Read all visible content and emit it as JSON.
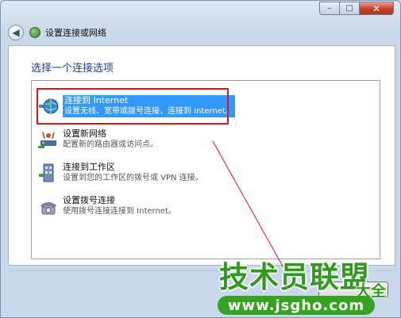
{
  "window": {
    "title": "设置连接或网络",
    "caption": {
      "minimize": "–",
      "maximize": "□",
      "close": "✕"
    },
    "back_glyph": "◀"
  },
  "heading": "选择一个连接选项",
  "options": [
    {
      "icon": "globe-network-icon",
      "title": "连接到 Internet",
      "desc": "设置无线、宽带或拨号连接，连接到 Internet。",
      "selected": true
    },
    {
      "icon": "router-icon",
      "title": "设置新网络",
      "desc": "配置新的路由器或访问点。",
      "selected": false
    },
    {
      "icon": "workplace-icon",
      "title": "连接到工作区",
      "desc": "设置到您的工作区的拨号或 VPN 连接。",
      "selected": false
    },
    {
      "icon": "dialup-phone-icon",
      "title": "设置拨号连接",
      "desc": "使用拨号连接连接到 Internet。",
      "selected": false
    }
  ],
  "watermark": {
    "main": "技术员联盟",
    "side": "大全",
    "url": "www.jsgho.com"
  },
  "colors": {
    "highlight": "#3399ff",
    "annotation": "#e0141e",
    "watermark": "#2f9a1d"
  }
}
